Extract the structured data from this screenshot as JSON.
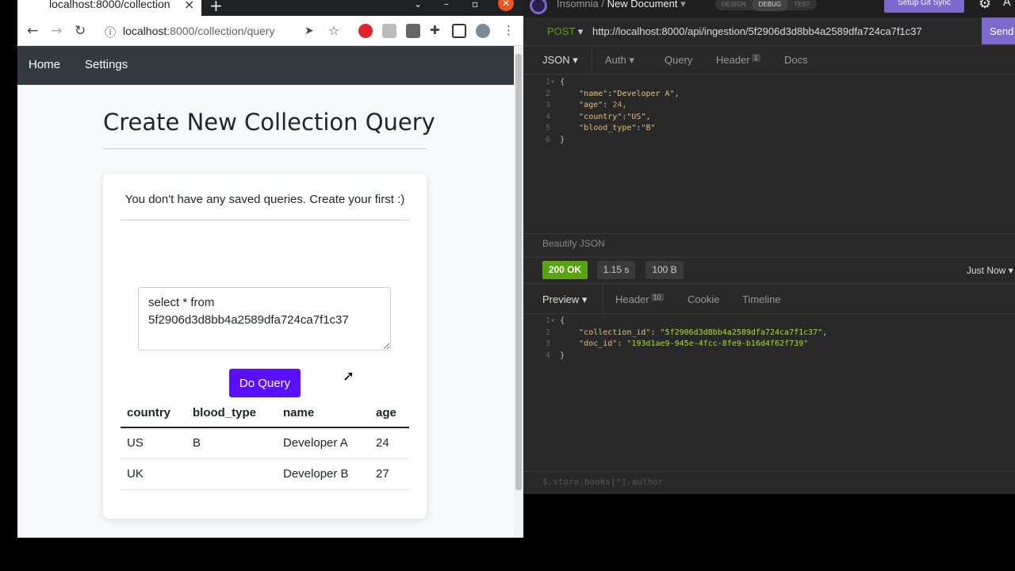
{
  "browser": {
    "tab_title": "localhost:8000/collection",
    "tab_close": "×",
    "new_tab": "+",
    "url_host": "localhost",
    "url_rest": ":8000/collection/query"
  },
  "nav": {
    "links": [
      "Home",
      "Settings"
    ]
  },
  "page": {
    "title": "Create New Collection Query",
    "empty_message": "You don't have any saved queries. Create your first :)",
    "query_text": "select * from\n5f2906d3d8bb4a2589dfa724ca7f1c37",
    "do_query_label": "Do Query",
    "table": {
      "headers": [
        "country",
        "blood_type",
        "name",
        "age"
      ],
      "rows": [
        [
          "US",
          "B",
          "Developer A",
          "24"
        ],
        [
          "UK",
          "",
          "Developer B",
          "27"
        ]
      ]
    }
  },
  "insomnia": {
    "app_name": "Insomnia",
    "separator": "/",
    "document": "New Document",
    "modes": [
      "DESIGN",
      "DEBUG",
      "TEST"
    ],
    "git_sync": "Setup Git Sync",
    "method": "POST",
    "url": "http://localhost:8000/api/ingestion/5f2906d3d8bb4a2589dfa724ca7f1c37",
    "send_label": "Send",
    "request_tabs": [
      "JSON",
      "Auth",
      "Query",
      "Header",
      "Docs"
    ],
    "request_header_count": "1",
    "beautify_label": "Beautify JSON",
    "status": "200 OK",
    "time": "1.15 s",
    "size": "100 B",
    "when": "Just Now",
    "response_tabs": [
      "Preview",
      "Header",
      "Cookie",
      "Timeline"
    ],
    "response_header_count": "10",
    "filter_placeholder": "$.store.books[*].author",
    "request_body": {
      "name": "Developer A",
      "age": "24",
      "country": "US",
      "blood_type": "B"
    },
    "response_body": {
      "collection_id": "5f2906d3d8bb4a2589dfa724ca7f1c37",
      "doc_id": "193d1ae9-945e-4fcc-8fe9-b16d4f62f739"
    }
  },
  "colors": {
    "accent_purple": "#5a0fff",
    "insomnia_purple": "#7d69cb",
    "status_green": "#59a210"
  }
}
